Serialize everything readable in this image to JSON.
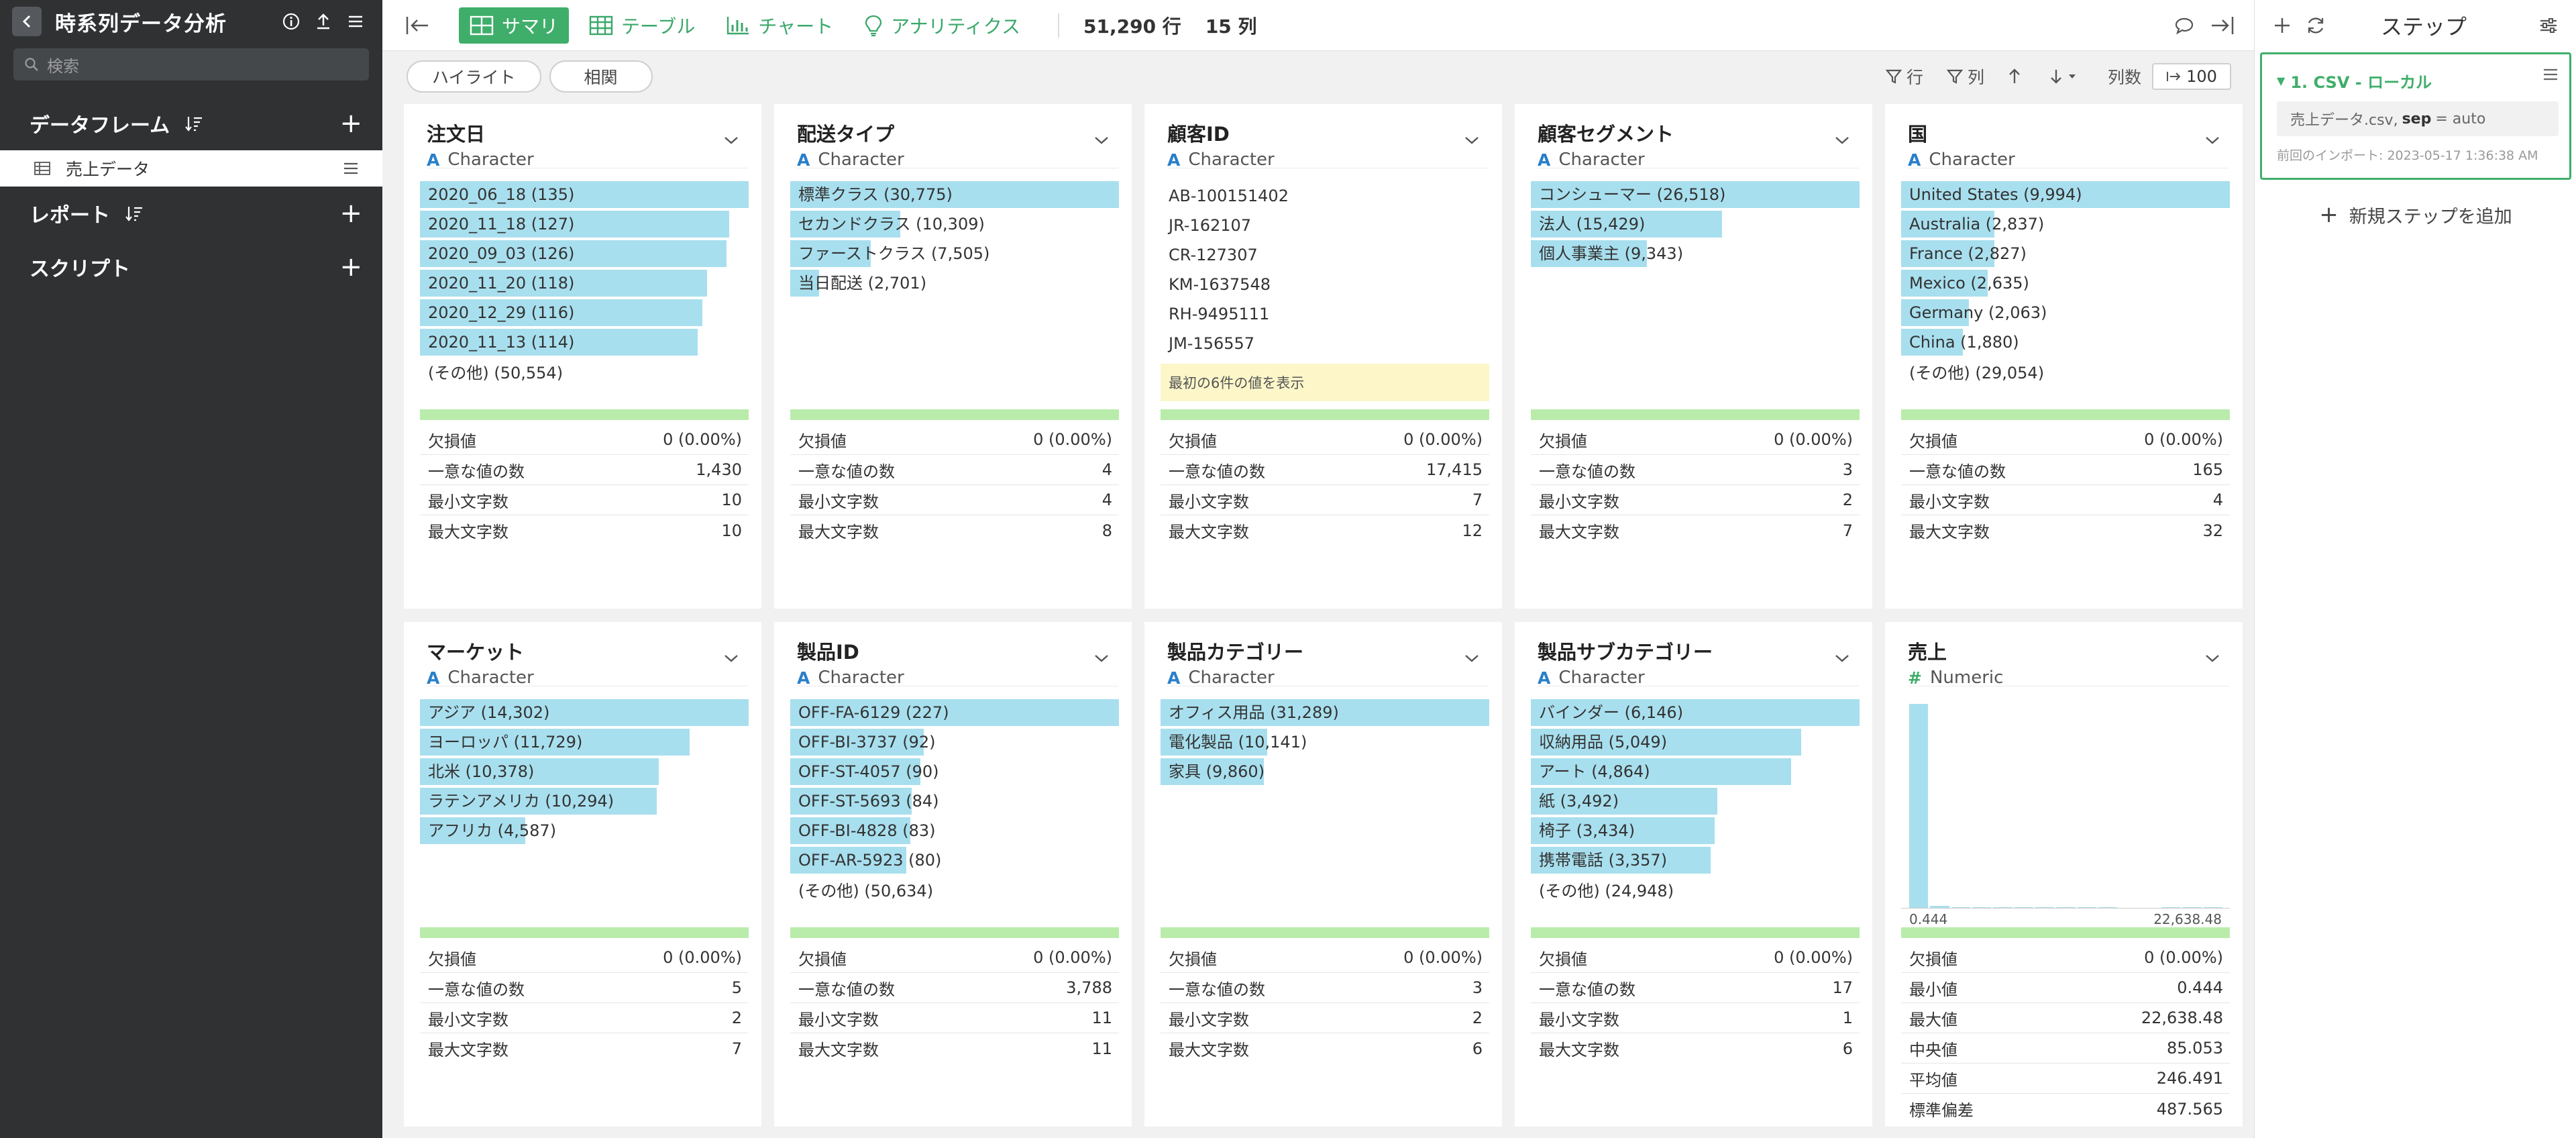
{
  "sidebar": {
    "title": "時系列データ分析",
    "search_placeholder": "検索",
    "sections": {
      "dataframes": "データフレーム",
      "reports": "レポート",
      "scripts": "スクリプト"
    },
    "dataframe_item": "売上データ"
  },
  "toolbar": {
    "tabs": [
      "サマリ",
      "テーブル",
      "チャート",
      "アナリティクス"
    ],
    "rows": "51,290 行",
    "cols": "15 列"
  },
  "subbar": {
    "highlight": "ハイライト",
    "correlation": "相関",
    "filter_rows": "行",
    "filter_cols": "列",
    "colcount_label": "列数",
    "colcount_value": "100"
  },
  "columns": [
    {
      "name": "注文日",
      "type": "Character",
      "type_icon": "A",
      "bars": [
        {
          "label": "2020_06_18 (135)",
          "ratio": 1.0
        },
        {
          "label": "2020_11_18 (127)",
          "ratio": 0.9407
        },
        {
          "label": "2020_09_03 (126)",
          "ratio": 0.9333
        },
        {
          "label": "2020_11_20 (118)",
          "ratio": 0.8741
        },
        {
          "label": "2020_12_29 (116)",
          "ratio": 0.8593
        },
        {
          "label": "2020_11_13 (114)",
          "ratio": 0.8444
        }
      ],
      "other": "(その他) (50,554)",
      "stats": [
        [
          "欠損値",
          "0 (0.00%)"
        ],
        [
          "一意な値の数",
          "1,430"
        ],
        [
          "最小文字数",
          "10"
        ],
        [
          "最大文字数",
          "10"
        ]
      ]
    },
    {
      "name": "配送タイプ",
      "type": "Character",
      "type_icon": "A",
      "bars": [
        {
          "label": "標準クラス (30,775)",
          "ratio": 1.0
        },
        {
          "label": "セカンドクラス (10,309)",
          "ratio": 0.335
        },
        {
          "label": "ファーストクラス (7,505)",
          "ratio": 0.2439
        },
        {
          "label": "当日配送 (2,701)",
          "ratio": 0.0878
        }
      ],
      "stats": [
        [
          "欠損値",
          "0 (0.00%)"
        ],
        [
          "一意な値の数",
          "4"
        ],
        [
          "最小文字数",
          "4"
        ],
        [
          "最大文字数",
          "8"
        ]
      ]
    },
    {
      "name": "顧客ID",
      "type": "Character",
      "type_icon": "A",
      "plain": [
        "AB-100151402",
        "JR-162107",
        "CR-127307",
        "KM-1637548",
        "RH-9495111",
        "JM-156557"
      ],
      "note": "最初の6件の値を表示",
      "stats": [
        [
          "欠損値",
          "0 (0.00%)"
        ],
        [
          "一意な値の数",
          "17,415"
        ],
        [
          "最小文字数",
          "7"
        ],
        [
          "最大文字数",
          "12"
        ]
      ]
    },
    {
      "name": "顧客セグメント",
      "type": "Character",
      "type_icon": "A",
      "bars": [
        {
          "label": "コンシューマー (26,518)",
          "ratio": 1.0
        },
        {
          "label": "法人 (15,429)",
          "ratio": 0.5818
        },
        {
          "label": "個人事業主 (9,343)",
          "ratio": 0.3523
        }
      ],
      "stats": [
        [
          "欠損値",
          "0 (0.00%)"
        ],
        [
          "一意な値の数",
          "3"
        ],
        [
          "最小文字数",
          "2"
        ],
        [
          "最大文字数",
          "7"
        ]
      ]
    },
    {
      "name": "国",
      "type": "Character",
      "type_icon": "A",
      "bars": [
        {
          "label": "United States (9,994)",
          "ratio": 1.0
        },
        {
          "label": "Australia (2,837)",
          "ratio": 0.2839
        },
        {
          "label": "France (2,827)",
          "ratio": 0.2829
        },
        {
          "label": "Mexico (2,635)",
          "ratio": 0.2637
        },
        {
          "label": "Germany (2,063)",
          "ratio": 0.2064
        },
        {
          "label": "China (1,880)",
          "ratio": 0.1881
        }
      ],
      "other": "(その他) (29,054)",
      "stats": [
        [
          "欠損値",
          "0 (0.00%)"
        ],
        [
          "一意な値の数",
          "165"
        ],
        [
          "最小文字数",
          "4"
        ],
        [
          "最大文字数",
          "32"
        ]
      ]
    },
    {
      "name": "マーケット",
      "type": "Character",
      "type_icon": "A",
      "bars": [
        {
          "label": "アジア (14,302)",
          "ratio": 1.0
        },
        {
          "label": "ヨーロッパ (11,729)",
          "ratio": 0.8201
        },
        {
          "label": "北米 (10,378)",
          "ratio": 0.7256
        },
        {
          "label": "ラテンアメリカ (10,294)",
          "ratio": 0.7198
        },
        {
          "label": "アフリカ (4,587)",
          "ratio": 0.3207
        }
      ],
      "stats": [
        [
          "欠損値",
          "0 (0.00%)"
        ],
        [
          "一意な値の数",
          "5"
        ],
        [
          "最小文字数",
          "2"
        ],
        [
          "最大文字数",
          "7"
        ]
      ]
    },
    {
      "name": "製品ID",
      "type": "Character",
      "type_icon": "A",
      "bars": [
        {
          "label": "OFF-FA-6129 (227)",
          "ratio": 1.0
        },
        {
          "label": "OFF-BI-3737 (92)",
          "ratio": 0.4053
        },
        {
          "label": "OFF-ST-4057 (90)",
          "ratio": 0.3965
        },
        {
          "label": "OFF-ST-5693 (84)",
          "ratio": 0.37
        },
        {
          "label": "OFF-BI-4828 (83)",
          "ratio": 0.3656
        },
        {
          "label": "OFF-AR-5923 (80)",
          "ratio": 0.3524
        }
      ],
      "other": "(その他) (50,634)",
      "stats": [
        [
          "欠損値",
          "0 (0.00%)"
        ],
        [
          "一意な値の数",
          "3,788"
        ],
        [
          "最小文字数",
          "11"
        ],
        [
          "最大文字数",
          "11"
        ]
      ]
    },
    {
      "name": "製品カテゴリー",
      "type": "Character",
      "type_icon": "A",
      "bars": [
        {
          "label": "オフィス用品 (31,289)",
          "ratio": 1.0
        },
        {
          "label": "電化製品 (10,141)",
          "ratio": 0.3241
        },
        {
          "label": "家具 (9,860)",
          "ratio": 0.3151
        }
      ],
      "stats": [
        [
          "欠損値",
          "0 (0.00%)"
        ],
        [
          "一意な値の数",
          "3"
        ],
        [
          "最小文字数",
          "2"
        ],
        [
          "最大文字数",
          "6"
        ]
      ]
    },
    {
      "name": "製品サブカテゴリー",
      "type": "Character",
      "type_icon": "A",
      "bars": [
        {
          "label": "バインダー (6,146)",
          "ratio": 1.0
        },
        {
          "label": "収納用品 (5,049)",
          "ratio": 0.8215
        },
        {
          "label": "アート (4,864)",
          "ratio": 0.7914
        },
        {
          "label": "紙 (3,492)",
          "ratio": 0.5682
        },
        {
          "label": "椅子 (3,434)",
          "ratio": 0.5587
        },
        {
          "label": "携帯電話 (3,357)",
          "ratio": 0.5462
        }
      ],
      "other": "(その他) (24,948)",
      "stats": [
        [
          "欠損値",
          "0 (0.00%)"
        ],
        [
          "一意な値の数",
          "17"
        ],
        [
          "最小文字数",
          "1"
        ],
        [
          "最大文字数",
          "6"
        ]
      ]
    },
    {
      "name": "売上",
      "type": "Numeric",
      "type_icon": "#",
      "histogram": {
        "bins": [
          1.0,
          0.012,
          0.008,
          0.006,
          0.004,
          0.003,
          0.002,
          0.001,
          0.001,
          0.001,
          0.0,
          0.0,
          0.001,
          0.001,
          0.001
        ],
        "min": "0.444",
        "max": "22,638.48"
      },
      "stats": [
        [
          "欠損値",
          "0 (0.00%)"
        ],
        [
          "最小値",
          "0.444"
        ],
        [
          "最大値",
          "22,638.48"
        ],
        [
          "中央値",
          "85.053"
        ],
        [
          "平均値",
          "246.491"
        ],
        [
          "標準偏差",
          "487.565"
        ]
      ]
    }
  ],
  "steps": {
    "title": "ステップ",
    "step_name": "1. CSV - ローカル",
    "step_file": "売上データ.csv,",
    "step_param_key": "sep",
    "step_param_eq": "= auto",
    "last_import": "前回のインポート: 2023-05-17 1:36:38 AM",
    "add_step": "新規ステップを追加"
  },
  "colors": {
    "accent": "#3fae6a",
    "bar": "#a8dfee",
    "sidebar": "#2f3133"
  }
}
